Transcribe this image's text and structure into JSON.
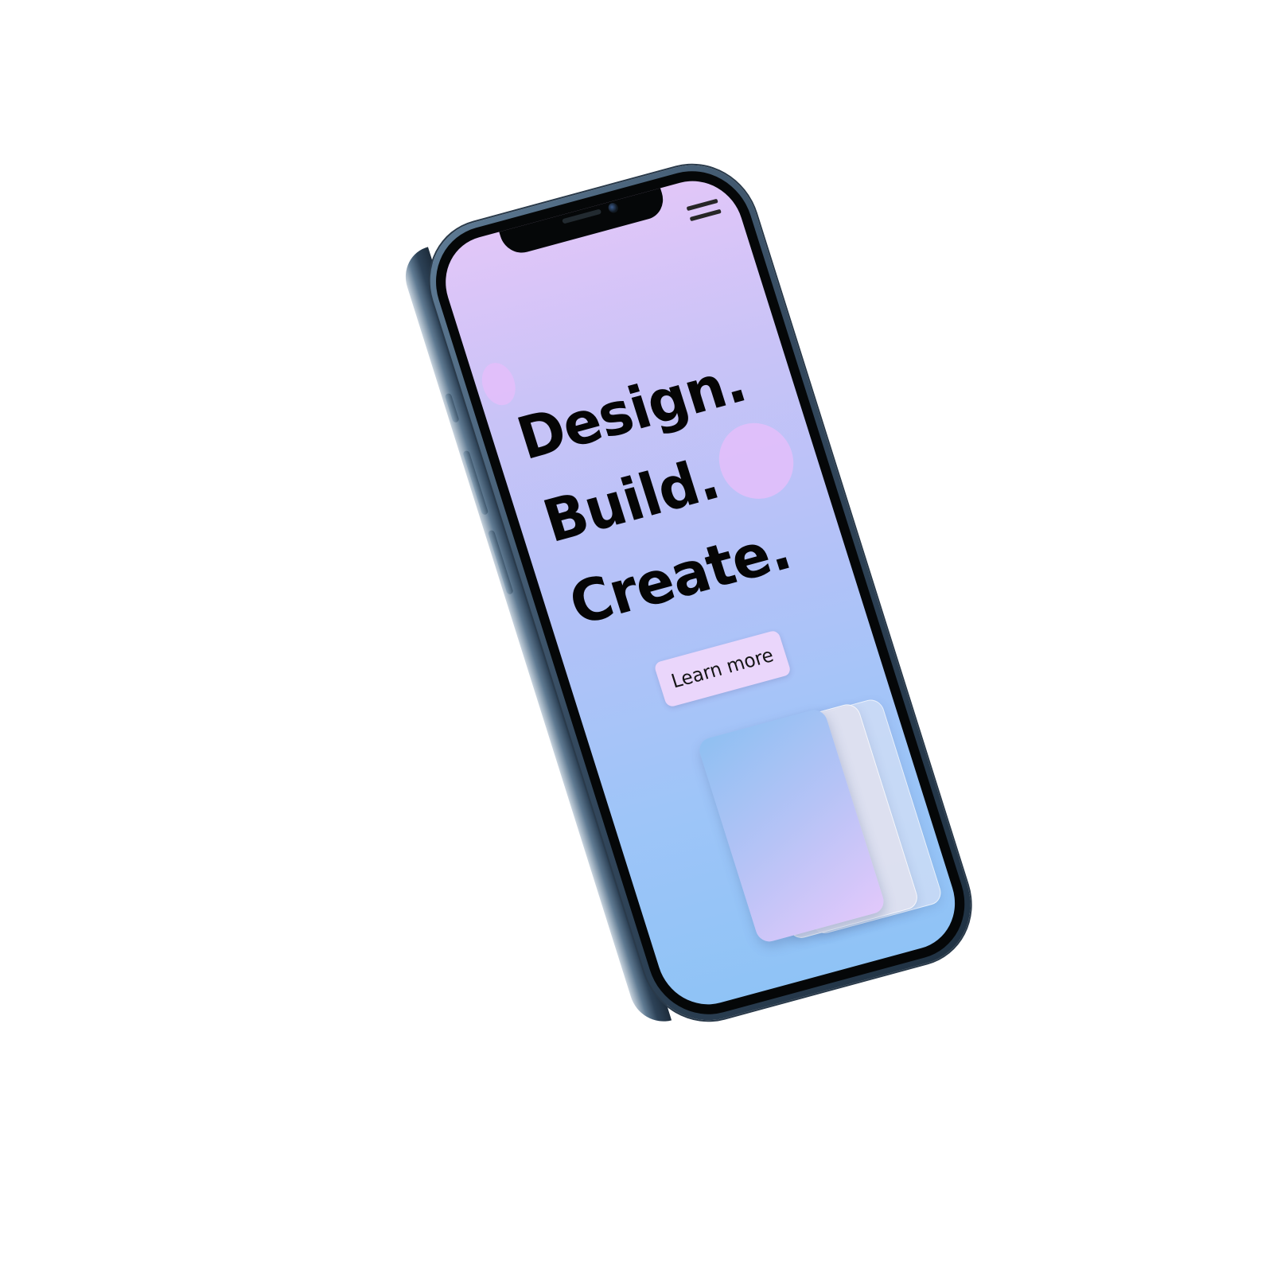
{
  "screen": {
    "headline": {
      "line1": "Design.",
      "line2": "Build.",
      "line3": "Create."
    },
    "cta": {
      "label": "Learn more"
    },
    "menu": {
      "icon": "hamburger-menu-icon"
    }
  },
  "colors": {
    "gradient_top": "#e1c6f8",
    "gradient_bottom": "#8fc3f6",
    "button_bg": "#ead6fb",
    "text": "#050505",
    "frame": "#34495e"
  }
}
